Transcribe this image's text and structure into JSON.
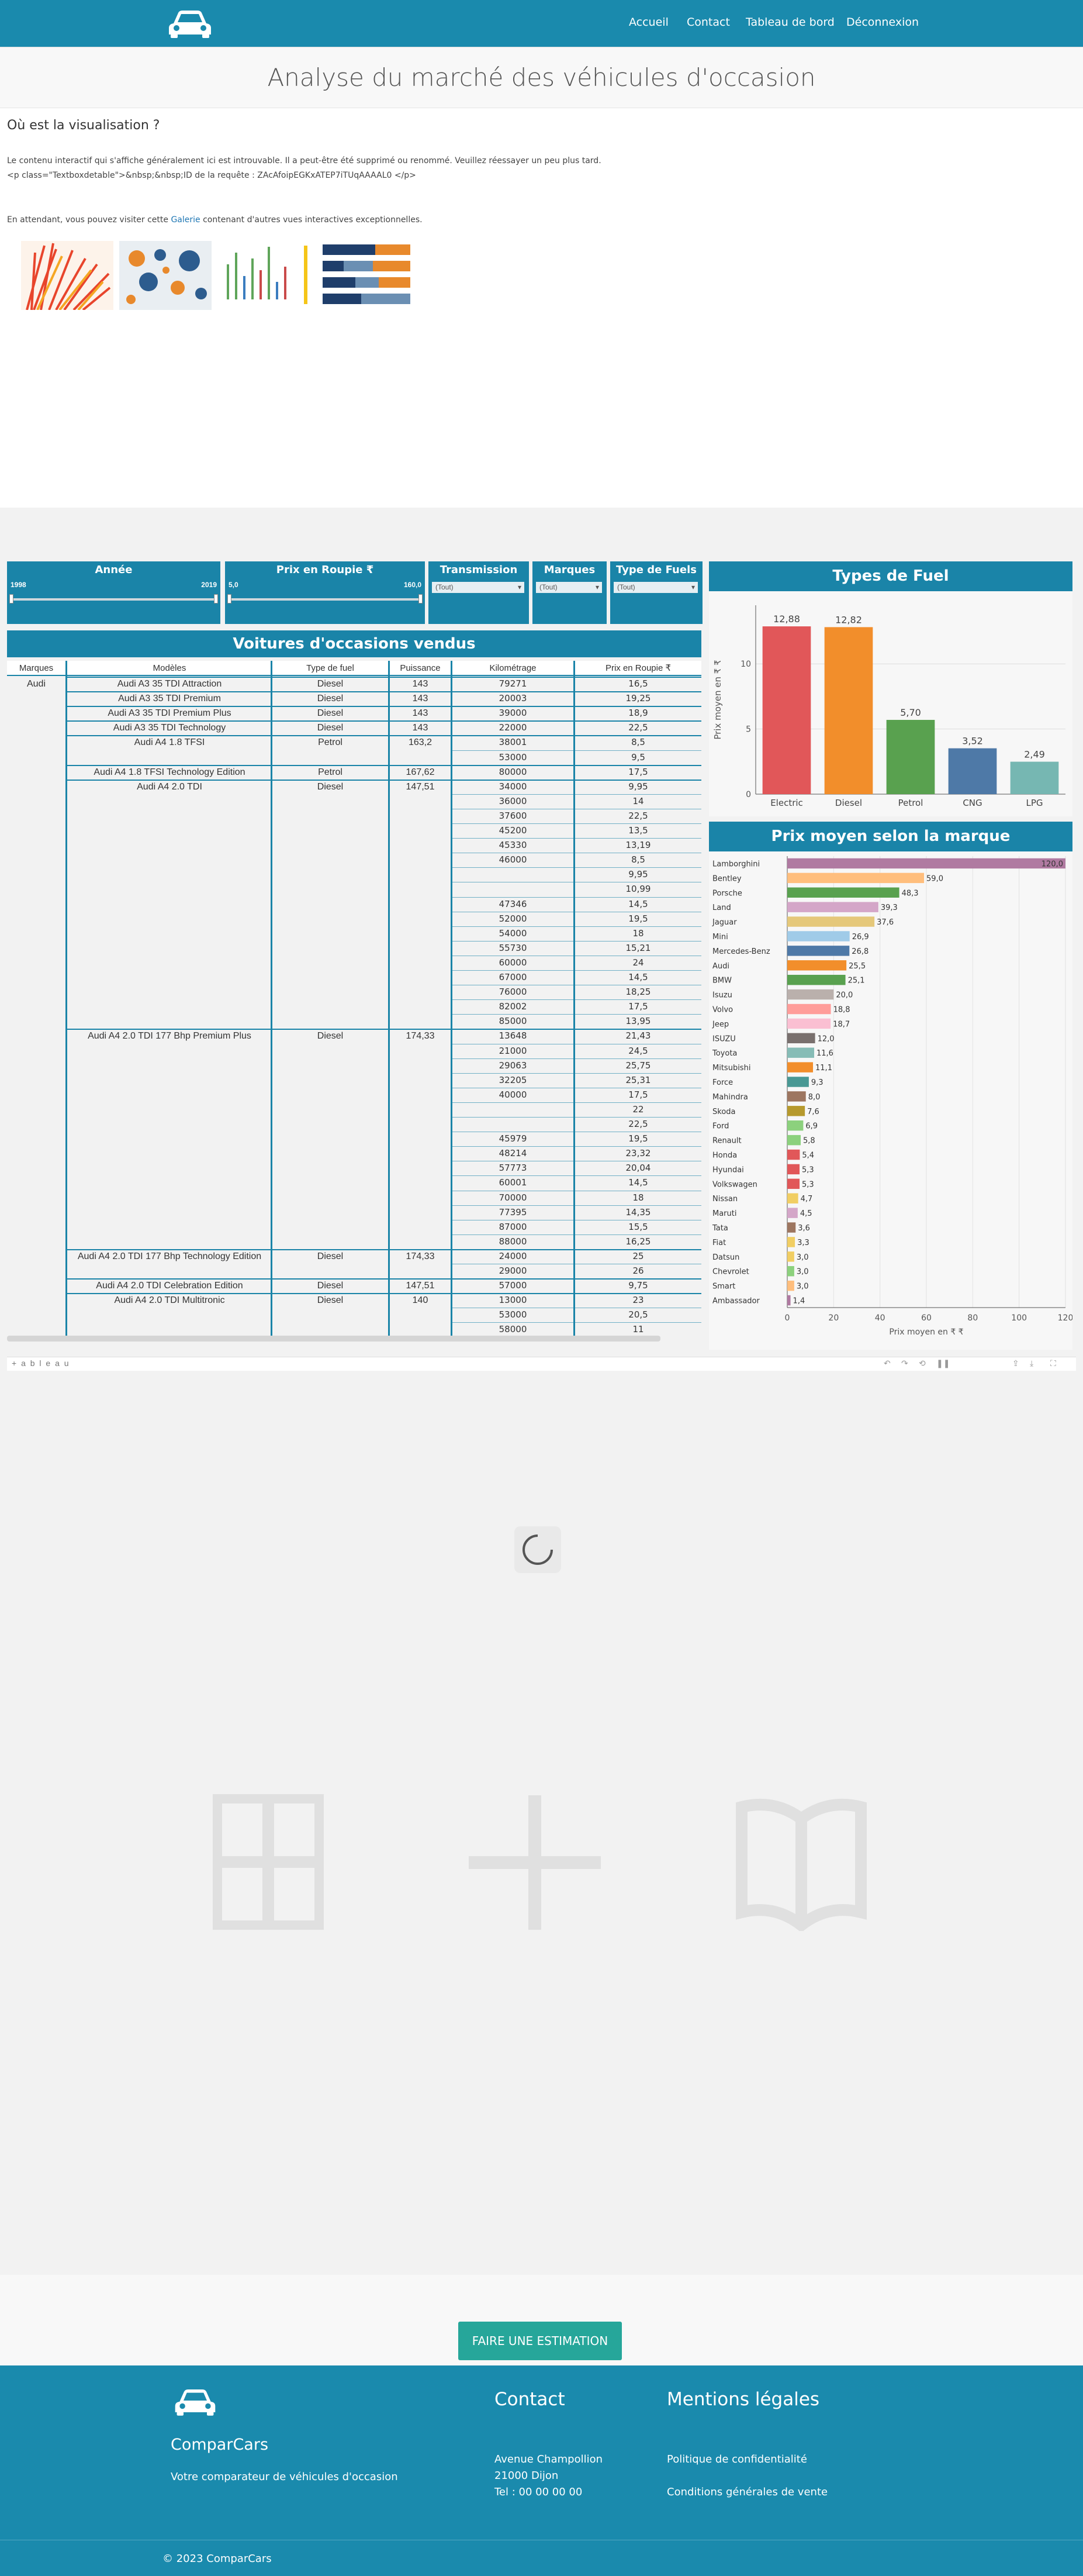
{
  "nav": {
    "links": [
      "Accueil",
      "Contact",
      "Tableau de bord",
      "Déconnexion"
    ]
  },
  "page": {
    "title": "Analyse du marché des véhicules d'occasion"
  },
  "embed_error": {
    "heading": "Où est la visualisation ?",
    "line1": "Le contenu interactif qui s'affiche généralement ici est introuvable.   Il a peut-être été supprimé ou renommé.   Veuillez réessayer un peu plus tard.",
    "line2": "<p class=\"Textboxdetable\">&nbsp;&nbsp;ID de la requête : ZAcAfoipEGKxATEP7iTUqAAAAL0 </p>",
    "line3_before": "En attendant, vous pouvez visiter cette ",
    "line3_link": "Galerie",
    "line3_after": " contenant d'autres vues interactives exceptionnelles."
  },
  "filters": {
    "annee": {
      "title": "Année",
      "min": "1998",
      "max": "2019"
    },
    "prix": {
      "title": "Prix en Roupie ₹",
      "min": "5,0",
      "max": "160,0"
    },
    "transmission": {
      "title": "Transmission",
      "value": "(Tout)"
    },
    "marques": {
      "title": "Marques",
      "value": "(Tout)"
    },
    "fuels": {
      "title": "Type de Fuels",
      "value": "(Tout)"
    }
  },
  "table": {
    "title": "Voitures d'occasions vendus",
    "headers": [
      "Marques",
      "Modèles",
      "Type de fuel",
      "Puissance",
      "Kilométrage",
      "Prix en Roupie ₹"
    ],
    "brand": "Audi",
    "groups": [
      {
        "model": "Audi A3 35 TDI Attraction",
        "fuel": "Diesel",
        "power": "143",
        "rows": [
          [
            "79271",
            "16,5"
          ]
        ]
      },
      {
        "model": "Audi A3 35 TDI Premium",
        "fuel": "Diesel",
        "power": "143",
        "rows": [
          [
            "20003",
            "19,25"
          ]
        ]
      },
      {
        "model": "Audi A3 35 TDI Premium Plus",
        "fuel": "Diesel",
        "power": "143",
        "rows": [
          [
            "39000",
            "18,9"
          ]
        ]
      },
      {
        "model": "Audi A3 35 TDI Technology",
        "fuel": "Diesel",
        "power": "143",
        "rows": [
          [
            "22000",
            "22,5"
          ]
        ]
      },
      {
        "model": "Audi A4 1.8 TFSI",
        "fuel": "Petrol",
        "power": "163,2",
        "rows": [
          [
            "38001",
            "8,5"
          ],
          [
            "53000",
            "9,5"
          ]
        ]
      },
      {
        "model": "Audi A4 1.8 TFSI Technology Edition",
        "fuel": "Petrol",
        "power": "167,62",
        "rows": [
          [
            "80000",
            "17,5"
          ]
        ]
      },
      {
        "model": "Audi A4 2.0 TDI",
        "fuel": "Diesel",
        "power": "147,51",
        "rows": [
          [
            "34000",
            "9,95"
          ],
          [
            "36000",
            "14"
          ],
          [
            "37600",
            "22,5"
          ],
          [
            "45200",
            "13,5"
          ],
          [
            "45330",
            "13,19"
          ],
          [
            "46000",
            "8,5"
          ],
          [
            "",
            "9,95"
          ],
          [
            "",
            "10,99"
          ],
          [
            "47346",
            "14,5"
          ],
          [
            "52000",
            "19,5"
          ],
          [
            "54000",
            "18"
          ],
          [
            "55730",
            "15,21"
          ],
          [
            "60000",
            "24"
          ],
          [
            "67000",
            "14,5"
          ],
          [
            "76000",
            "18,25"
          ],
          [
            "82002",
            "17,5"
          ],
          [
            "85000",
            "13,95"
          ]
        ]
      },
      {
        "model": "Audi A4 2.0 TDI 177 Bhp Premium Plus",
        "fuel": "Diesel",
        "power": "174,33",
        "rows": [
          [
            "13648",
            "21,43"
          ],
          [
            "21000",
            "24,5"
          ],
          [
            "29063",
            "25,75"
          ],
          [
            "32205",
            "25,31"
          ],
          [
            "40000",
            "17,5"
          ],
          [
            "",
            "22"
          ],
          [
            "",
            "22,5"
          ],
          [
            "45979",
            "19,5"
          ],
          [
            "48214",
            "23,32"
          ],
          [
            "57773",
            "20,04"
          ],
          [
            "60001",
            "14,5"
          ],
          [
            "70000",
            "18"
          ],
          [
            "77395",
            "14,35"
          ],
          [
            "87000",
            "15,5"
          ],
          [
            "88000",
            "16,25"
          ]
        ]
      },
      {
        "model": "Audi A4 2.0 TDI 177 Bhp Technology Edition",
        "fuel": "Diesel",
        "power": "174,33",
        "rows": [
          [
            "24000",
            "25"
          ],
          [
            "29000",
            "26"
          ]
        ]
      },
      {
        "model": "Audi A4 2.0 TDI Celebration Edition",
        "fuel": "Diesel",
        "power": "147,51",
        "rows": [
          [
            "57000",
            "9,75"
          ]
        ]
      },
      {
        "model": "Audi A4 2.0 TDI Multitronic",
        "fuel": "Diesel",
        "power": "140",
        "rows": [
          [
            "13000",
            "23"
          ],
          [
            "53000",
            "20,5"
          ],
          [
            "58000",
            "11"
          ]
        ]
      }
    ]
  },
  "chart_data": [
    {
      "type": "bar",
      "title": "Types de Fuel",
      "ylabel": "Prix moyen en ₹ ₹",
      "categories": [
        "Electric",
        "Diesel",
        "Petrol",
        "CNG",
        "LPG"
      ],
      "values": [
        12.88,
        12.82,
        5.7,
        3.52,
        2.49
      ],
      "value_labels": [
        "12,88",
        "12,82",
        "5,70",
        "3,52",
        "2,49"
      ],
      "colors": [
        "#e15759",
        "#f28e2b",
        "#59a14f",
        "#4e79a7",
        "#76b7b2"
      ],
      "ylim": [
        0,
        14.5
      ],
      "yticks": [
        "0",
        "5",
        "10"
      ],
      "grid": true
    },
    {
      "type": "bar",
      "orientation": "horizontal",
      "title": "Prix moyen selon la marque",
      "xlabel": "Prix moyen en ₹ ₹",
      "categories": [
        "Lamborghini",
        "Bentley",
        "Porsche",
        "Land",
        "Jaguar",
        "Mini",
        "Mercedes-Benz",
        "Audi",
        "BMW",
        "Isuzu",
        "Volvo",
        "Jeep",
        "ISUZU",
        "Toyota",
        "Mitsubishi",
        "Force",
        "Mahindra",
        "Skoda",
        "Ford",
        "Renault",
        "Honda",
        "Hyundai",
        "Volkswagen",
        "Nissan",
        "Maruti",
        "Tata",
        "Fiat",
        "Datsun",
        "Chevrolet",
        "Smart",
        "Ambassador"
      ],
      "values": [
        120.0,
        59.0,
        48.3,
        39.3,
        37.6,
        26.9,
        26.8,
        25.5,
        25.1,
        20.0,
        18.8,
        18.7,
        12.0,
        11.6,
        11.1,
        9.3,
        8.0,
        7.6,
        6.9,
        5.8,
        5.4,
        5.3,
        5.3,
        4.7,
        4.5,
        3.6,
        3.3,
        3.0,
        3.0,
        3.0,
        1.4
      ],
      "value_labels": [
        "120,0",
        "59,0",
        "48,3",
        "39,3",
        "37,6",
        "26,9",
        "26,8",
        "25,5",
        "25,1",
        "20,0",
        "18,8",
        "18,7",
        "12,0",
        "11,6",
        "11,1",
        "9,3",
        "8,0",
        "7,6",
        "6,9",
        "5,8",
        "5,4",
        "5,3",
        "5,3",
        "4,7",
        "4,5",
        "3,6",
        "3,3",
        "3,0",
        "3,0",
        "3,0",
        "1,4"
      ],
      "colors": [
        "#b07aa1",
        "#ffbe7d",
        "#59a14f",
        "#d4a6c8",
        "#e5c87a",
        "#a0cbe8",
        "#4e79a7",
        "#f28e2b",
        "#59a14f",
        "#bab0ac",
        "#ff9d9a",
        "#fabfd2",
        "#79706e",
        "#86bcb6",
        "#f28e2b",
        "#499894",
        "#9d7660",
        "#b6992d",
        "#8cd17d",
        "#8cd17d",
        "#e15759",
        "#e15759",
        "#e15759",
        "#f1ce63",
        "#d4a6c8",
        "#9d7660",
        "#f1ce63",
        "#f1ce63",
        "#8cd17d",
        "#ffbe7d",
        "#b07aa1"
      ],
      "xlim": [
        0,
        120
      ],
      "xticks": [
        "0",
        "20",
        "40",
        "60",
        "80",
        "100",
        "120"
      ],
      "grid": true
    }
  ],
  "toolbar": {
    "tableau": "+ a b l e a u"
  },
  "cta": {
    "label": "FAIRE UNE ESTIMATION"
  },
  "footer": {
    "brand": "ComparCars",
    "tagline": "Votre comparateur de véhicules d'occasion",
    "contact_title": "Contact",
    "address1": "Avenue Champollion",
    "address2": "21000 Dijon",
    "phone": "Tel : 00 00 00 00",
    "legal_title": "Mentions légales",
    "privacy": "Politique de confidentialité",
    "terms": "Conditions générales de vente",
    "copyright": "© 2023 ComparCars"
  }
}
